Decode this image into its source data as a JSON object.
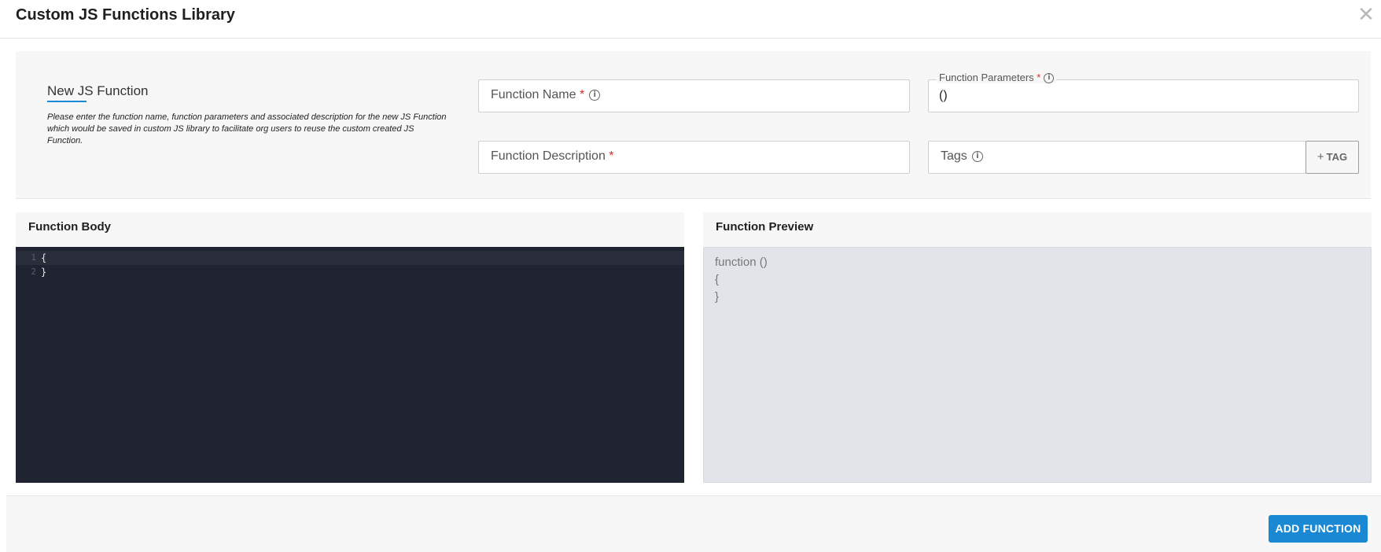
{
  "header": {
    "title": "Custom JS Functions Library",
    "close_symbol": "✕"
  },
  "form": {
    "section_title": "New JS Function",
    "description": "Please enter the function name, function parameters and associated description for the new JS Function which would be saved in custom JS library to facilitate org users to reuse the custom created JS Function.",
    "function_name": {
      "label": "Function Name",
      "required_mark": "*",
      "value": ""
    },
    "function_parameters": {
      "label": "Function Parameters",
      "required_mark": "*",
      "value": "()"
    },
    "function_description": {
      "label": "Function Description",
      "required_mark": "*",
      "value": ""
    },
    "tags": {
      "label": "Tags",
      "value": ""
    },
    "tag_button": {
      "plus": "+",
      "label": "TAG"
    }
  },
  "function_body": {
    "title": "Function Body",
    "lines": [
      {
        "number": "1",
        "code": "{"
      },
      {
        "number": "2",
        "code": "}"
      }
    ]
  },
  "function_preview": {
    "title": "Function Preview",
    "lines": [
      "function ()",
      "{",
      "}"
    ]
  },
  "footer": {
    "add_button": "ADD FUNCTION"
  },
  "icons": {
    "info": "i"
  },
  "colors": {
    "accent": "#1b88d4",
    "required": "#d32f2f",
    "editor_bg": "#202430"
  }
}
